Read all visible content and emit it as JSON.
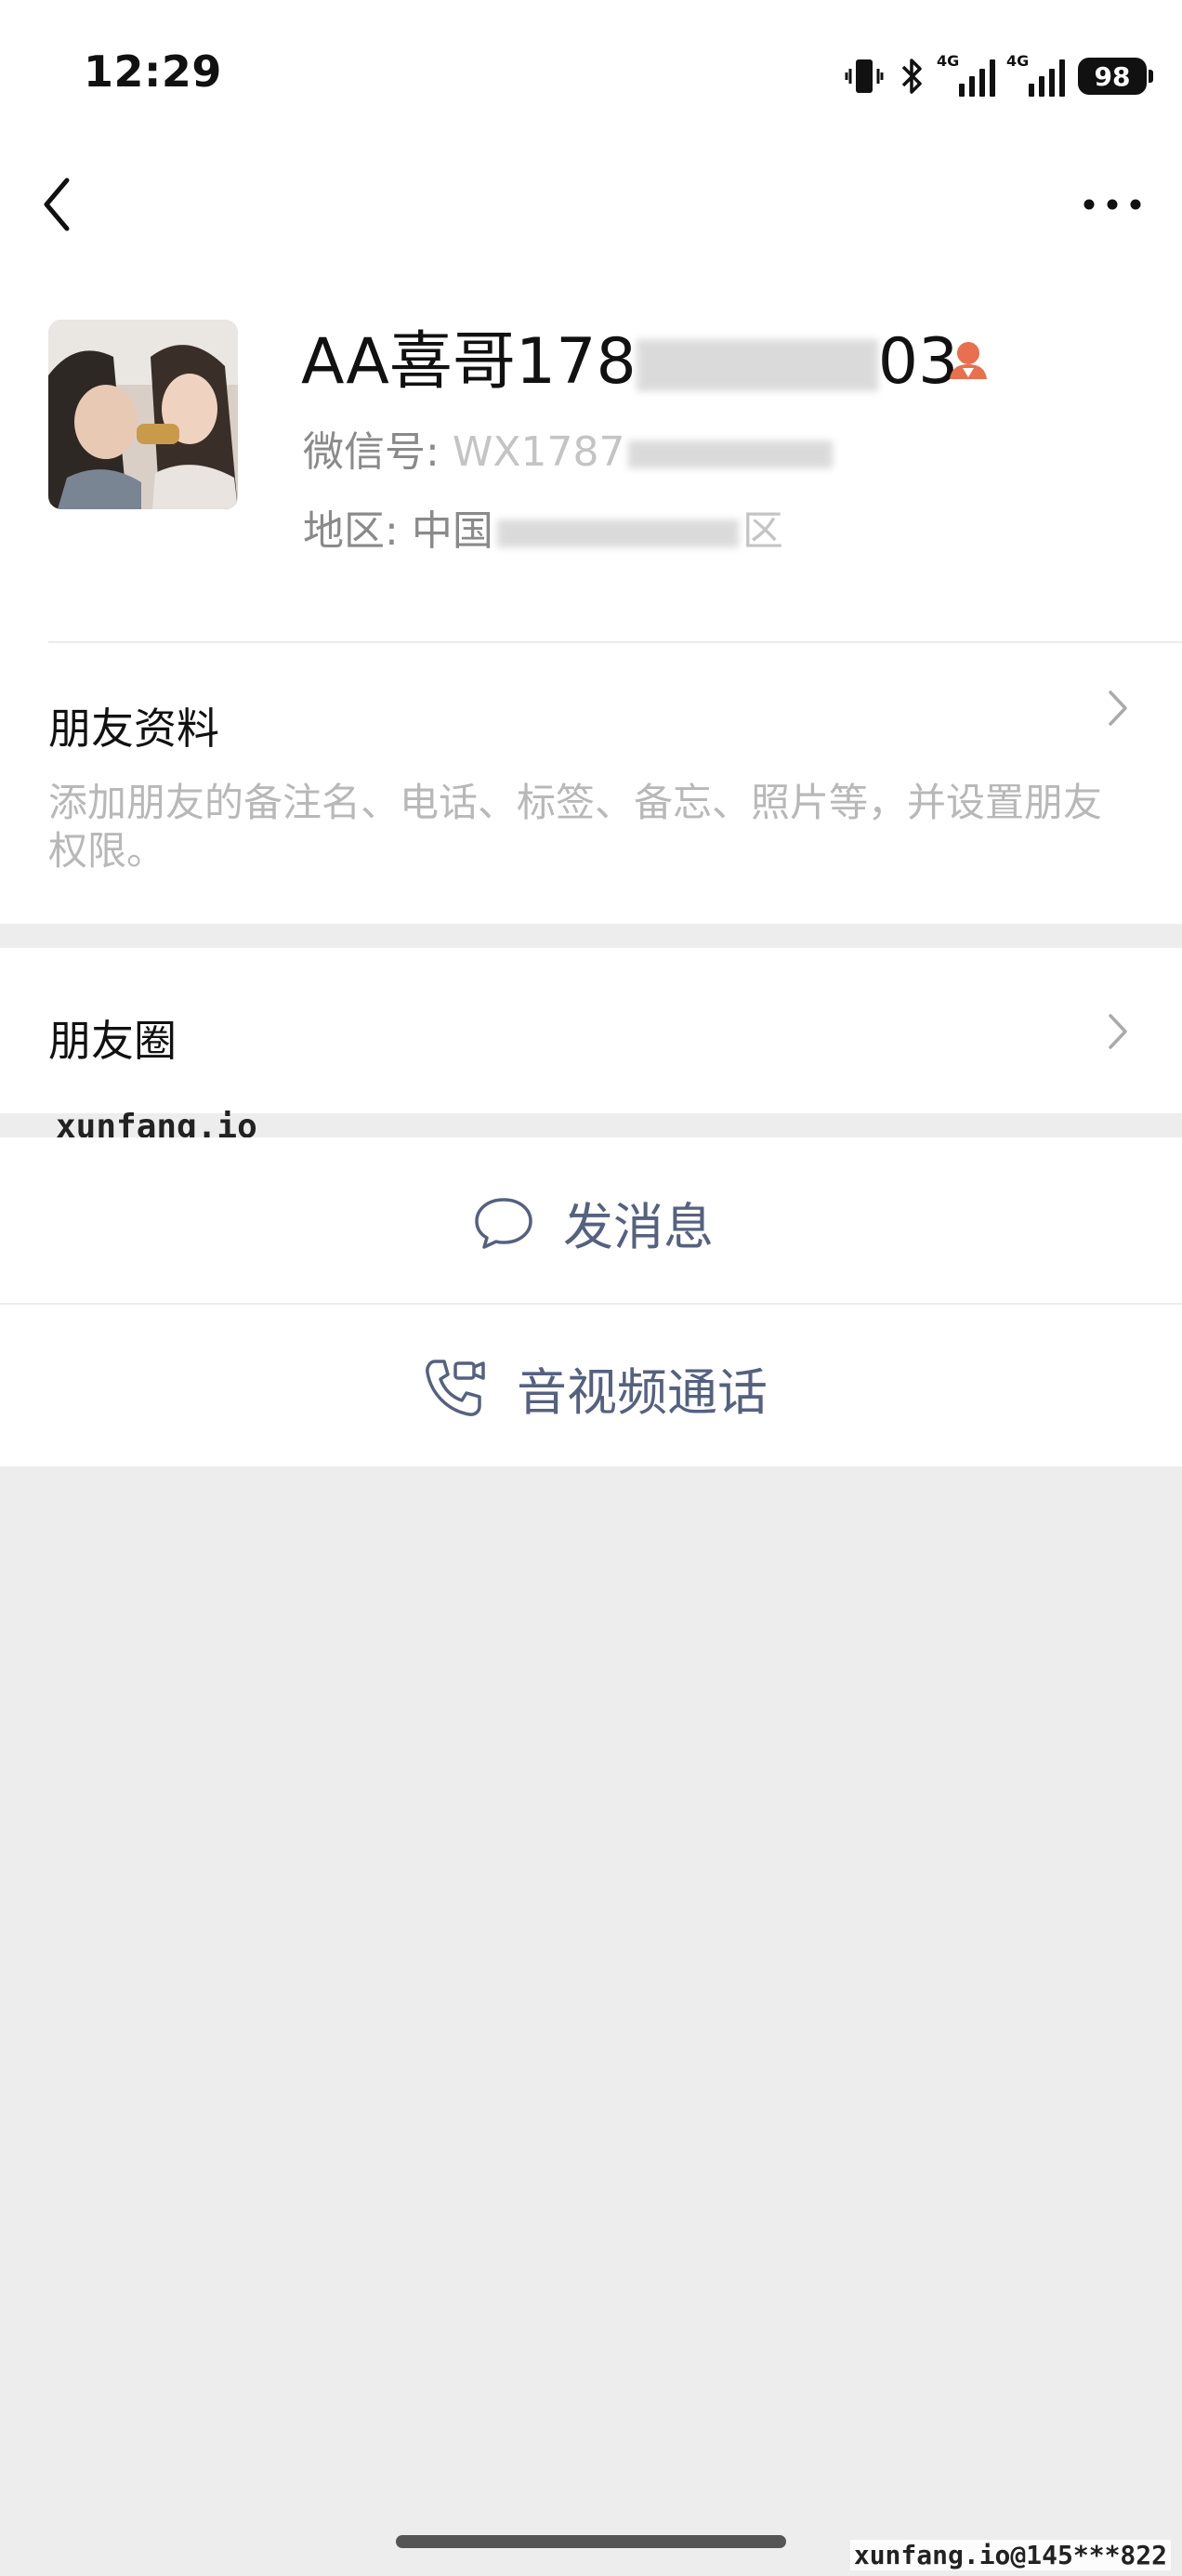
{
  "status_bar": {
    "time": "12:29",
    "signal1_label": "4G",
    "signal2_label": "4G",
    "battery": "98"
  },
  "profile": {
    "name_prefix": "AA喜哥178",
    "name_suffix": "03",
    "wechat_id_label": "微信号:",
    "wechat_id_value": "WX1787",
    "region_label": "地区:",
    "region_value": "中国",
    "region_end": "区"
  },
  "friend_info": {
    "title": "朋友资料",
    "description": "添加朋友的备注名、电话、标签、备忘、照片等，并设置朋友权限。"
  },
  "moments": {
    "title": "朋友圈"
  },
  "actions": {
    "message": "发消息",
    "call": "音视频通话"
  },
  "watermarks": {
    "site": "xunfang.io",
    "footer": "xunfang.io@145***822"
  },
  "colors": {
    "background": "#ededed",
    "action_text": "#55617f",
    "person_icon": "#e8704f"
  }
}
